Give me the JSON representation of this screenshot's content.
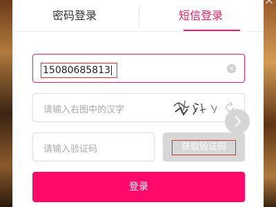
{
  "tabs": {
    "password_login": "密码登录",
    "sms_login": "短信登录",
    "active": "sms_login",
    "accent_color": "#e6216a"
  },
  "phone": {
    "value": "15080685813",
    "clear_icon": "clear-circle-icon"
  },
  "captcha": {
    "placeholder": "请输入右图中的汉字",
    "refresh_icon": "refresh-icon"
  },
  "sms_code": {
    "placeholder": "请输入验证码",
    "button_label": "获取验证码"
  },
  "login_button": {
    "label": "登录",
    "color": "#ff0a6a"
  },
  "close_icon": "close-icon",
  "next_icon": "chevron-right-icon"
}
